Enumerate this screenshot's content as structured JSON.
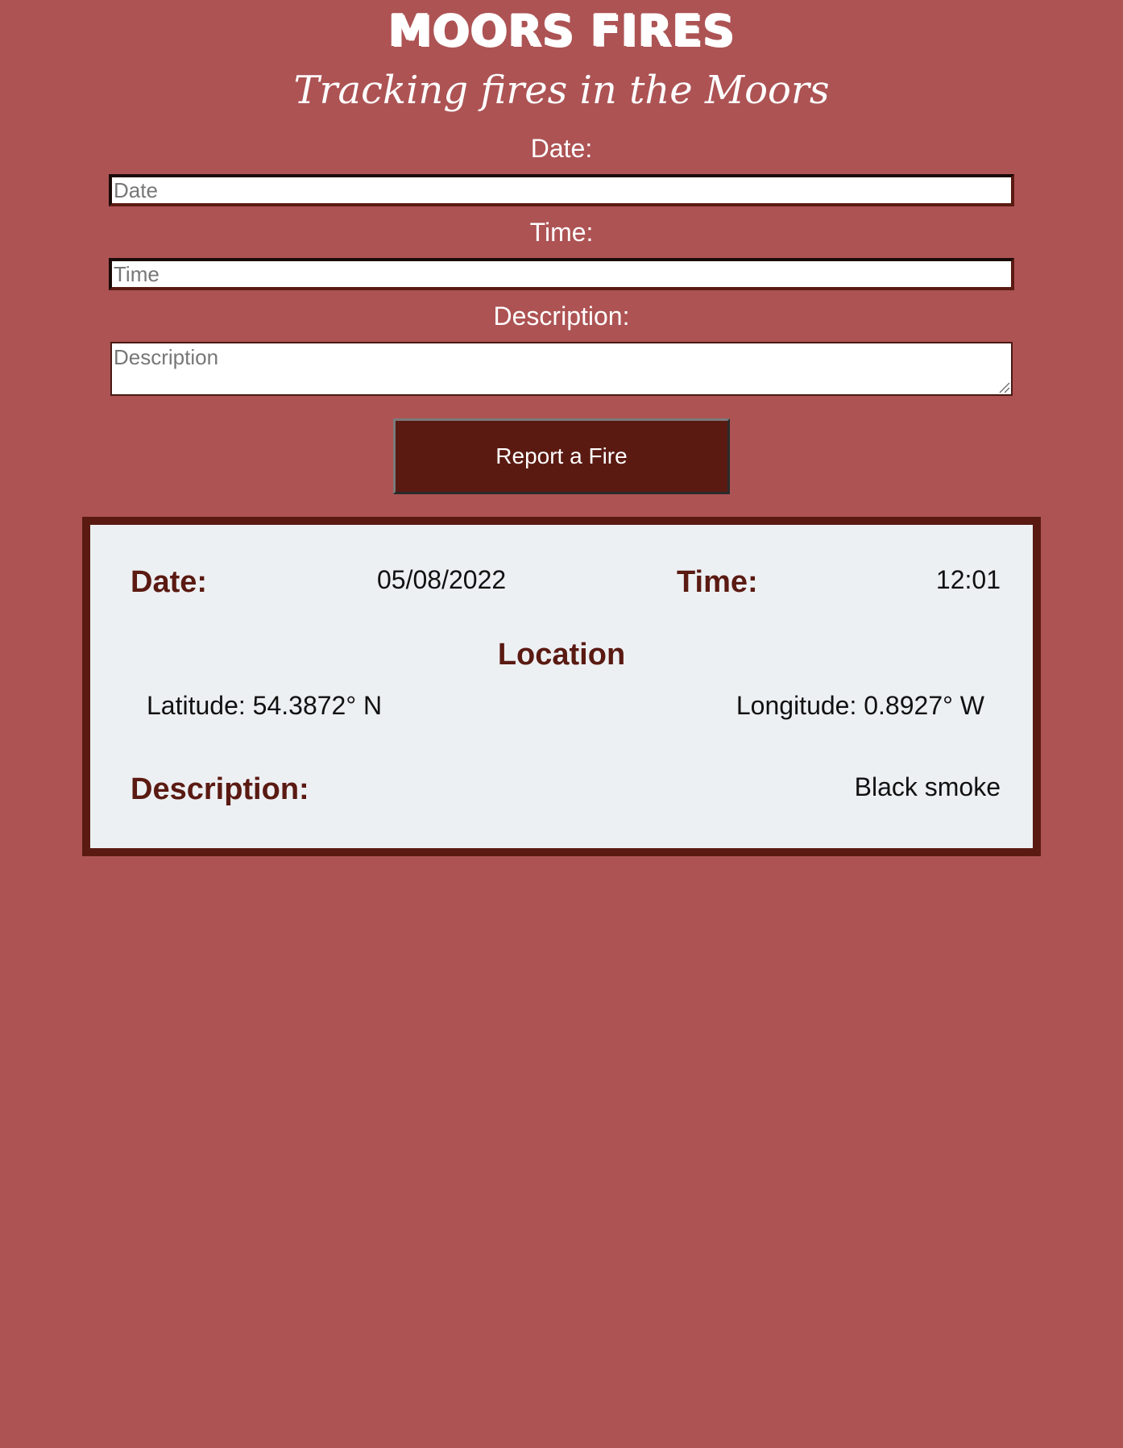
{
  "header": {
    "title": "Moors Fires",
    "subtitle": "Tracking fires in the Moors"
  },
  "form": {
    "date_label": "Date:",
    "date_placeholder": "Date",
    "time_label": "Time:",
    "time_placeholder": "Time",
    "description_label": "Description:",
    "description_placeholder": "Description",
    "submit_label": "Report a Fire"
  },
  "report": {
    "date_label": "Date:",
    "date_value": "05/08/2022",
    "time_label": "Time:",
    "time_value": "12:01",
    "location_heading": "Location",
    "latitude": "Latitude: 54.3872° N",
    "longitude": "Longitude: 0.8927° W",
    "description_label": "Description:",
    "description_value": "Black smoke"
  },
  "colors": {
    "background": "#ad5354",
    "accent": "#5a1a12",
    "card_background": "#edf0f3"
  }
}
